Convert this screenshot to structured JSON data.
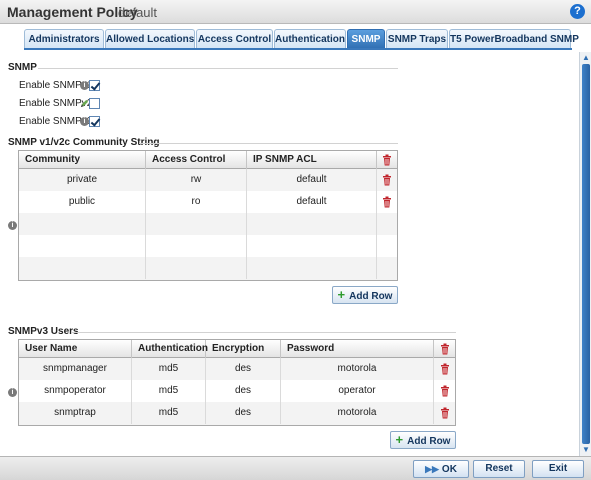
{
  "header": {
    "title": "Management Policy",
    "subtitle": "default",
    "help_icon": "question-mark-icon"
  },
  "tabs": [
    {
      "label": "Administrators",
      "active": false
    },
    {
      "label": "Allowed Locations",
      "active": false
    },
    {
      "label": "Access Control",
      "active": false
    },
    {
      "label": "Authentication",
      "active": false
    },
    {
      "label": "SNMP",
      "active": true
    },
    {
      "label": "SNMP Traps",
      "active": false
    },
    {
      "label": "T5 PowerBroadband SNMP",
      "active": false
    }
  ],
  "snmp": {
    "section_title": "SNMP",
    "options": [
      {
        "label": "Enable SNMPv1",
        "checked": true,
        "icon": "info-icon"
      },
      {
        "label": "Enable SNMPv2",
        "checked": false,
        "icon": "pencil-icon"
      },
      {
        "label": "Enable SNMPv3",
        "checked": true,
        "icon": "info-icon"
      }
    ]
  },
  "community": {
    "section_title": "SNMP v1/v2c Community String",
    "columns": [
      "Community",
      "Access Control",
      "IP SNMP ACL"
    ],
    "rows": [
      [
        "private",
        "rw",
        "default"
      ],
      [
        "public",
        "ro",
        "default"
      ]
    ],
    "add_row_label": "Add Row"
  },
  "v3users": {
    "section_title": "SNMPv3 Users",
    "columns": [
      "User Name",
      "Authentication",
      "Encryption",
      "Password"
    ],
    "rows": [
      [
        "snmpmanager",
        "md5",
        "des",
        "motorola"
      ],
      [
        "snmpoperator",
        "md5",
        "des",
        "operator"
      ],
      [
        "snmptrap",
        "md5",
        "des",
        "motorola"
      ]
    ],
    "add_row_label": "Add Row"
  },
  "footer": {
    "ok_label": "OK",
    "reset_label": "Reset",
    "exit_label": "Exit"
  },
  "colors": {
    "accent": "#2f6eb2",
    "delete": "#c0262d",
    "add": "#2e9b2e"
  }
}
